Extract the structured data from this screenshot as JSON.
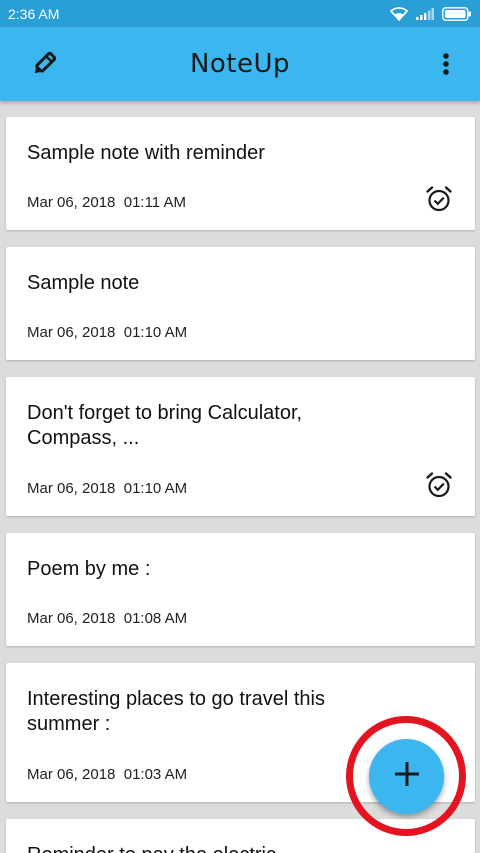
{
  "status_bar": {
    "time": "2:36 AM",
    "icons": [
      "wifi-icon",
      "signal-icon",
      "battery-icon"
    ]
  },
  "app_bar": {
    "title": "NoteUp",
    "left_icon": "pencil-icon",
    "right_icon": "more-vert-icon",
    "color": "#3bb6ee"
  },
  "notes": [
    {
      "title": "Sample note with reminder",
      "date": "Mar 06, 2018  01:11 AM",
      "has_reminder": true
    },
    {
      "title": "Sample note",
      "date": "Mar 06, 2018  01:10 AM",
      "has_reminder": false
    },
    {
      "title": "Don't forget to bring Calculator, Compass, ...",
      "date": "Mar 06, 2018  01:10 AM",
      "has_reminder": true
    },
    {
      "title": "Poem by me :",
      "date": "Mar 06, 2018  01:08 AM",
      "has_reminder": false
    },
    {
      "title": "Interesting places to go travel this summer :",
      "date": "Mar 06, 2018  01:03 AM",
      "has_reminder": false
    },
    {
      "title": "Reminder to pay the electric",
      "date": "",
      "has_reminder": false
    }
  ],
  "fab": {
    "icon": "plus-icon",
    "highlight_color": "#e3131f"
  }
}
